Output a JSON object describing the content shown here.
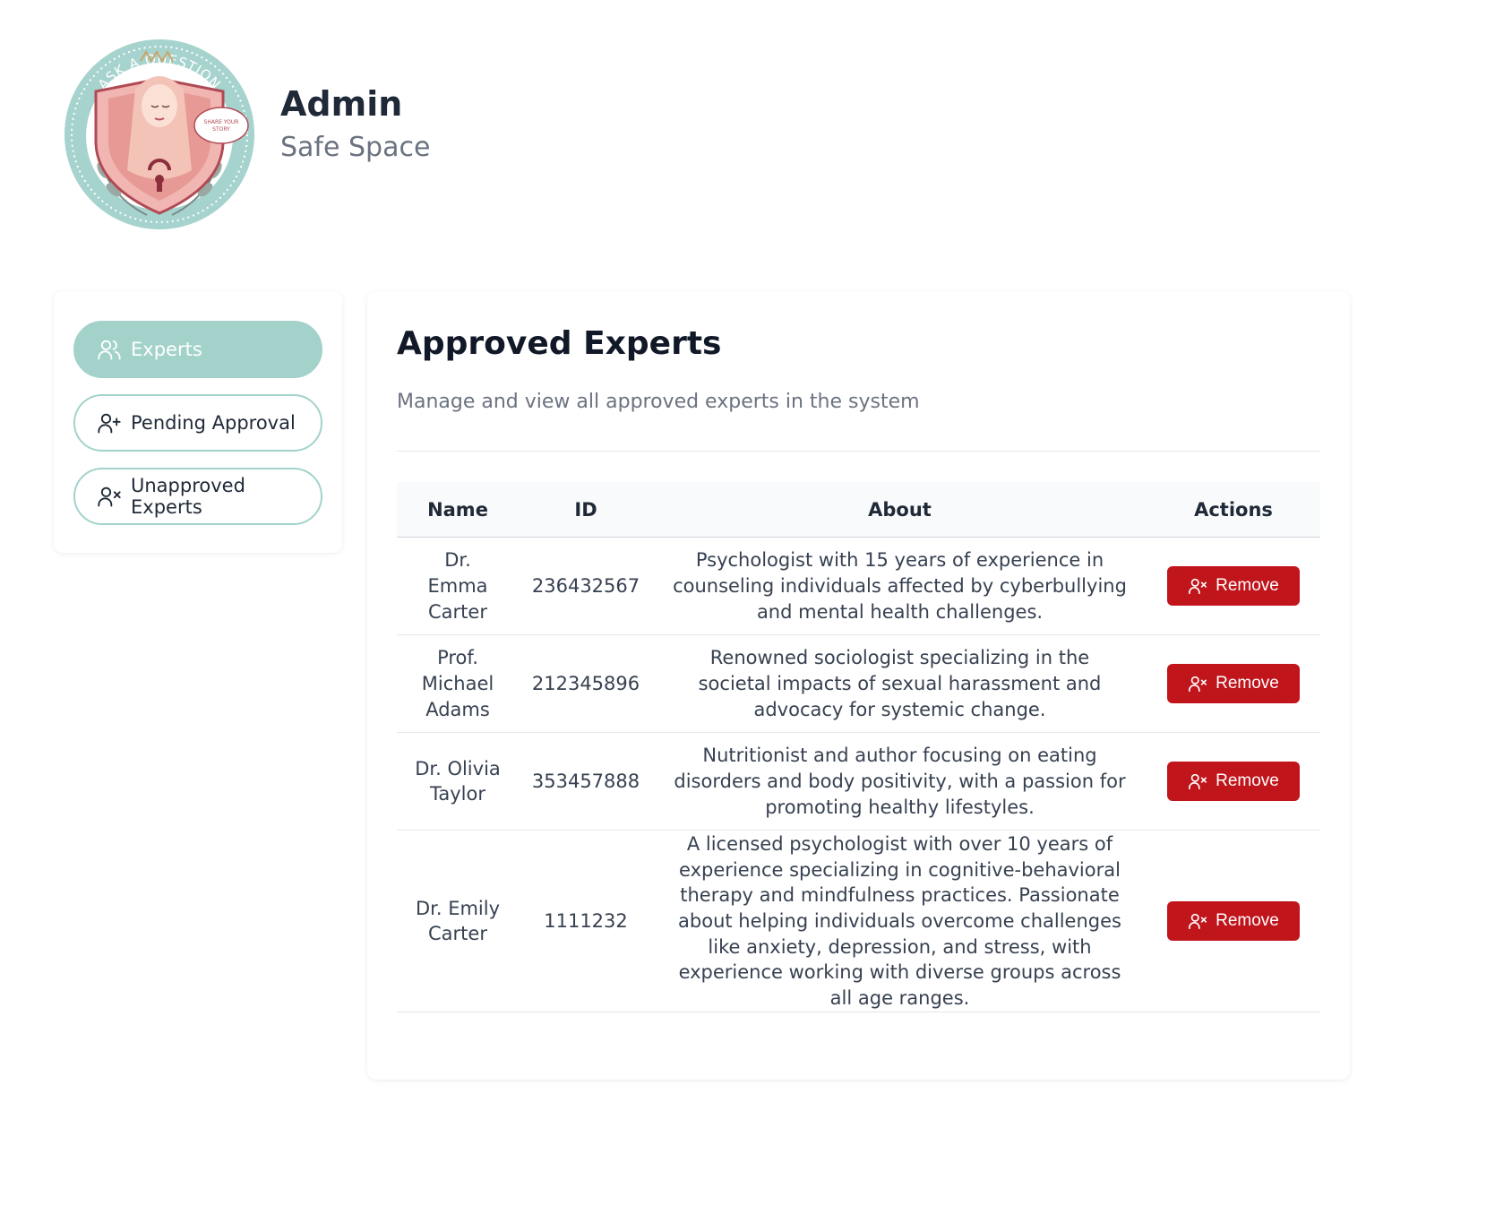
{
  "header": {
    "title": "Admin",
    "subtitle": "Safe Space",
    "logo": {
      "ring_text": "ASK A QUESTION",
      "bubble_text": "SHARE YOUR STORY"
    }
  },
  "sidebar": {
    "items": [
      {
        "label": "Experts",
        "icon": "users-icon",
        "active": true
      },
      {
        "label": "Pending Approval",
        "icon": "user-plus-icon",
        "active": false
      },
      {
        "label": "Unapproved Experts",
        "icon": "user-x-icon",
        "active": false
      }
    ]
  },
  "main": {
    "title": "Approved Experts",
    "description": "Manage and view all approved experts in the system",
    "table": {
      "headers": {
        "name": "Name",
        "id": "ID",
        "about": "About",
        "actions": "Actions"
      },
      "rows": [
        {
          "name": "Dr. Emma Carter",
          "id": "236432567",
          "about": "Psychologist with 15 years of experience in counseling individuals affected by cyberbullying and mental health challenges.",
          "action": "Remove"
        },
        {
          "name": "Prof. Michael Adams",
          "id": "212345896",
          "about": "Renowned sociologist specializing in the societal impacts of sexual harassment and advocacy for systemic change.",
          "action": "Remove"
        },
        {
          "name": "Dr. Olivia Taylor",
          "id": "353457888",
          "about": "Nutritionist and author focusing on eating disorders and body positivity, with a passion for promoting healthy lifestyles.",
          "action": "Remove"
        },
        {
          "name": "Dr. Emily Carter",
          "id": "1111232",
          "about": "A licensed psychologist with over 10 years of experience specializing in cognitive-behavioral therapy and mindfulness practices. Passionate about helping individuals overcome challenges like anxiety, depression, and stress, with experience working with diverse groups across all age ranges.",
          "action": "Remove"
        }
      ]
    }
  },
  "colors": {
    "accent": "#a3d2cb",
    "danger": "#c0151b",
    "logo_ring": "#8fc3bd",
    "logo_shield": "#e8a3a3"
  }
}
